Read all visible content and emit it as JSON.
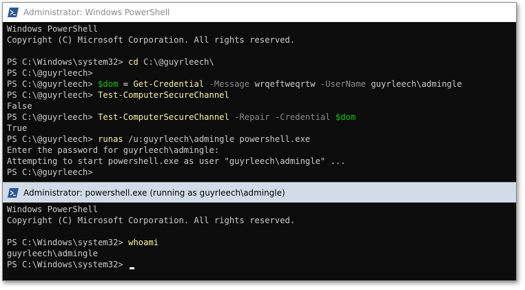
{
  "window1": {
    "title": "Administrator: Windows PowerShell",
    "lines": [
      [
        {
          "t": "Windows PowerShell",
          "c": ""
        }
      ],
      [
        {
          "t": "Copyright (C) Microsoft Corporation. All rights reserved.",
          "c": ""
        }
      ],
      [],
      [
        {
          "t": "PS C:\\Windows\\system32> ",
          "c": ""
        },
        {
          "t": "cd",
          "c": "yel"
        },
        {
          "t": " C:\\@guyrleech\\",
          "c": ""
        }
      ],
      [
        {
          "t": "PS C:\\@guyrleech> ",
          "c": ""
        }
      ],
      [
        {
          "t": "PS C:\\@guyrleech> ",
          "c": ""
        },
        {
          "t": "$dom",
          "c": "grn"
        },
        {
          "t": " = ",
          "c": "wht"
        },
        {
          "t": "Get-Credential",
          "c": "yel"
        },
        {
          "t": " -Message ",
          "c": "gry"
        },
        {
          "t": "wrqeftweqrtw",
          "c": ""
        },
        {
          "t": " -UserName ",
          "c": "gry"
        },
        {
          "t": "guyrleech\\admingle",
          "c": ""
        }
      ],
      [
        {
          "t": "PS C:\\@guyrleech> ",
          "c": ""
        },
        {
          "t": "Test-ComputerSecureChannel",
          "c": "yel"
        }
      ],
      [
        {
          "t": "False",
          "c": ""
        }
      ],
      [
        {
          "t": "PS C:\\@guyrleech> ",
          "c": ""
        },
        {
          "t": "Test-ComputerSecureChannel",
          "c": "yel"
        },
        {
          "t": " -Repair -Credential ",
          "c": "gry"
        },
        {
          "t": "$dom",
          "c": "grn"
        }
      ],
      [
        {
          "t": "True",
          "c": ""
        }
      ],
      [
        {
          "t": "PS C:\\@guyrleech> ",
          "c": ""
        },
        {
          "t": "runas",
          "c": "yel"
        },
        {
          "t": " /u:guyrleech\\admingle powershell.exe",
          "c": ""
        }
      ],
      [
        {
          "t": "Enter the password for guyrleech\\admingle:",
          "c": ""
        }
      ],
      [
        {
          "t": "Attempting to start powershell.exe as user \"guyrleech\\admingle\" ...",
          "c": ""
        }
      ],
      [
        {
          "t": "PS C:\\@guyrleech> ",
          "c": ""
        }
      ]
    ]
  },
  "window2": {
    "title": "Administrator: powershell.exe (running as guyrleech\\admingle)",
    "lines": [
      [
        {
          "t": "Windows PowerShell",
          "c": ""
        }
      ],
      [
        {
          "t": "Copyright (C) Microsoft Corporation. All rights reserved.",
          "c": ""
        }
      ],
      [],
      [
        {
          "t": "PS C:\\Windows\\system32> ",
          "c": ""
        },
        {
          "t": "whoami",
          "c": "yel"
        }
      ],
      [
        {
          "t": "guyrleech\\admingle",
          "c": ""
        }
      ],
      [
        {
          "t": "PS C:\\Windows\\system32> ",
          "c": ""
        }
      ]
    ]
  },
  "colors": {
    "console_bg": "#0c0c0c",
    "console_fg": "#cccccc",
    "command_yellow": "#f9f1a5",
    "variable_green": "#16c60c",
    "parameter_gray": "#8a8a8a",
    "inactive_title_bg": "#ffffff",
    "active_title_bg": "#d1dce8",
    "icon_blue": "#2b5797"
  },
  "icons": {
    "window_icon": "powershell-icon",
    "cursor": "text-cursor"
  }
}
